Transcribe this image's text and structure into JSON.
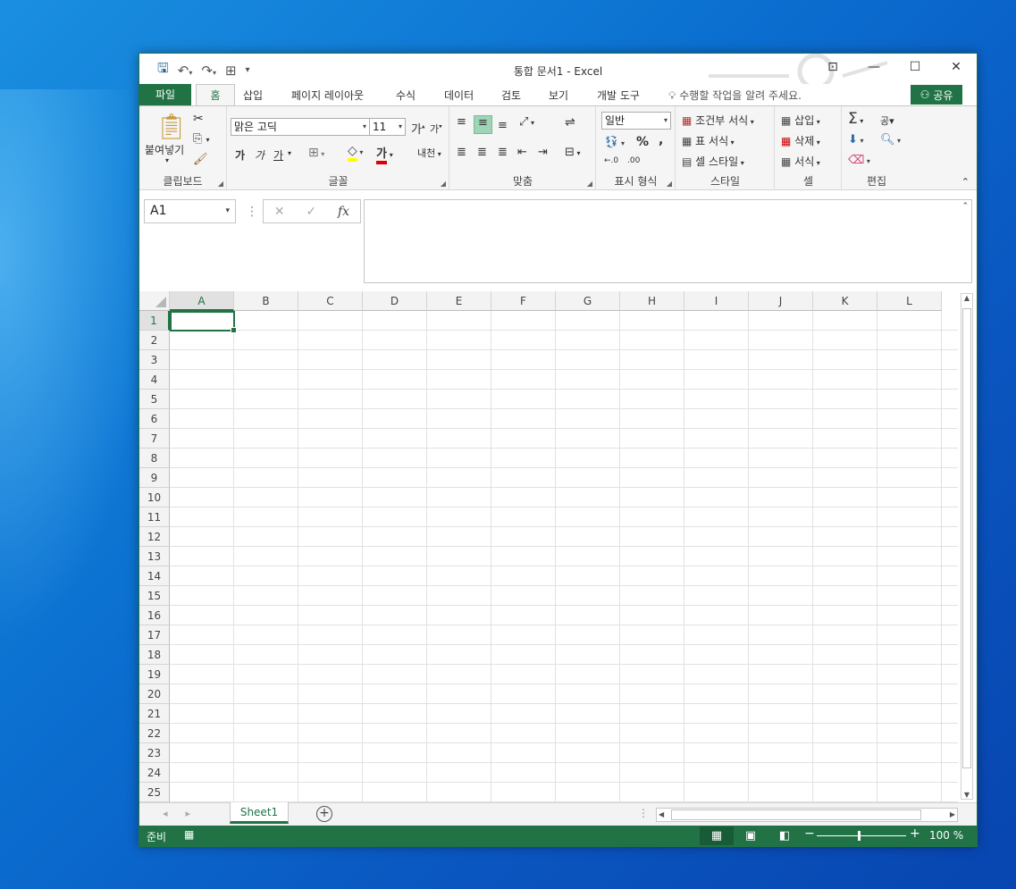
{
  "window": {
    "title": "통합 문서1 - Excel"
  },
  "qat": {
    "save": "save-icon",
    "undo": "undo-icon",
    "redo": "redo-icon",
    "customize": "customize-icon"
  },
  "tabs": [
    {
      "label": "파일"
    },
    {
      "label": "홈"
    },
    {
      "label": "삽입"
    },
    {
      "label": "페이지 레이아웃"
    },
    {
      "label": "수식"
    },
    {
      "label": "데이터"
    },
    {
      "label": "검토"
    },
    {
      "label": "보기"
    },
    {
      "label": "개발 도구"
    }
  ],
  "tellme": "수행할 작업을 알려 주세요.",
  "share": "공유",
  "ribbon": {
    "clipboard": {
      "paste": "붙여넣기",
      "label": "클립보드"
    },
    "font": {
      "name": "맑은 고딕",
      "size": "11",
      "grow": "가",
      "shrink": "가",
      "bold": "가",
      "italic": "가",
      "underline": "가",
      "font_color": "가",
      "phonetic": "내천",
      "label": "글꼴"
    },
    "align": {
      "label": "맞춤"
    },
    "number": {
      "format": "일반",
      "percent": "%",
      "comma": ",",
      "inc": "←.0",
      "dec": ".00",
      "label": "표시 형식"
    },
    "styles": {
      "cond": "조건부 서식",
      "table": "표 서식",
      "cell": "셀 스타일",
      "label": "스타일"
    },
    "cells": {
      "insert": "삽입",
      "delete": "삭제",
      "format": "서식",
      "label": "셀"
    },
    "editing": {
      "sum": "Σ",
      "sort": "공▾",
      "label": "편집"
    }
  },
  "formula_bar": {
    "name_box": "A1",
    "cancel": "✕",
    "enter": "✓",
    "fx": "fx",
    "value": ""
  },
  "grid": {
    "columns": [
      "A",
      "B",
      "C",
      "D",
      "E",
      "F",
      "G",
      "H",
      "I",
      "J",
      "K",
      "L"
    ],
    "rows": [
      "1",
      "2",
      "3",
      "4",
      "5",
      "6",
      "7",
      "8",
      "9",
      "10",
      "11",
      "12",
      "13",
      "14",
      "15",
      "16",
      "17",
      "18",
      "19",
      "20",
      "21",
      "22",
      "23",
      "24",
      "25"
    ],
    "active_cell": "A1"
  },
  "sheets": {
    "tabs": [
      "Sheet1"
    ],
    "active": "Sheet1"
  },
  "status": {
    "ready": "준비",
    "zoom": "100 %"
  },
  "colors": {
    "accent": "#217346",
    "status_bg": "#217346"
  }
}
